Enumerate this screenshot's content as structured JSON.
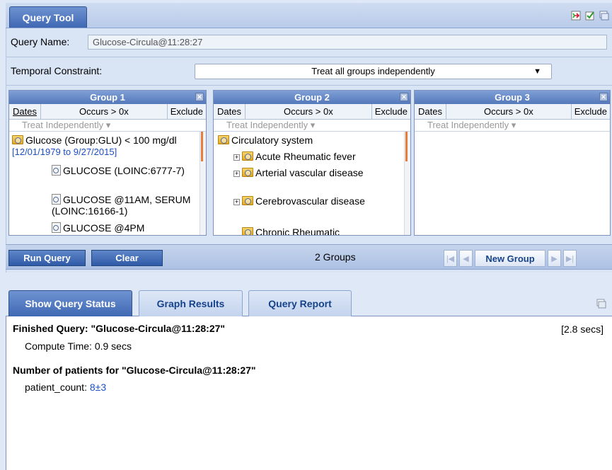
{
  "query_tool": {
    "tab_label": "Query Tool",
    "icons": [
      "export-icon",
      "check-icon",
      "window-icon"
    ],
    "query_name_label": "Query Name:",
    "query_name_value": "Glucose-Circula@11:28:27",
    "temporal_label": "Temporal Constraint:",
    "temporal_value": "Treat all groups independently",
    "groups": [
      {
        "title": "Group 1",
        "dates": "Dates",
        "occurs": "Occurs > 0x",
        "exclude": "Exclude",
        "treat": "Treat Independently ▾",
        "items": {
          "root": "Glucose (Group:GLU) < 100 mg/dl",
          "root_range": "[12/01/1979 to 9/27/2015]",
          "child1": "GLUCOSE (LOINC:6777-7)",
          "child2": "GLUCOSE @11AM, SERUM (LOINC:16166-1)",
          "child3": "GLUCOSE @4PM"
        }
      },
      {
        "title": "Group 2",
        "dates": "Dates",
        "occurs": "Occurs > 0x",
        "exclude": "Exclude",
        "treat": "Treat Independently ▾",
        "items": {
          "root": "Circulatory system",
          "child1": "Acute Rheumatic fever",
          "child2": "Arterial vascular disease",
          "child3": "Cerebrovascular disease",
          "child4": "Chronic Rheumatic"
        }
      },
      {
        "title": "Group 3",
        "dates": "Dates",
        "occurs": "Occurs > 0x",
        "exclude": "Exclude",
        "treat": "Treat Independently ▾"
      }
    ],
    "run_query": "Run Query",
    "clear": "Clear",
    "groups_count": "2 Groups",
    "new_group": "New Group"
  },
  "status": {
    "tabs": [
      "Show Query Status",
      "Graph Results",
      "Query Report"
    ],
    "finished_line": "Finished Query: \"Glucose-Circula@11:28:27\"",
    "elapsed": "[2.8 secs]",
    "compute_time": "Compute Time: 0.9 secs",
    "patients_heading": "Number of patients for \"Glucose-Circula@11:28:27\"",
    "patient_count_label": "patient_count:",
    "patient_count_value": "8±3"
  }
}
